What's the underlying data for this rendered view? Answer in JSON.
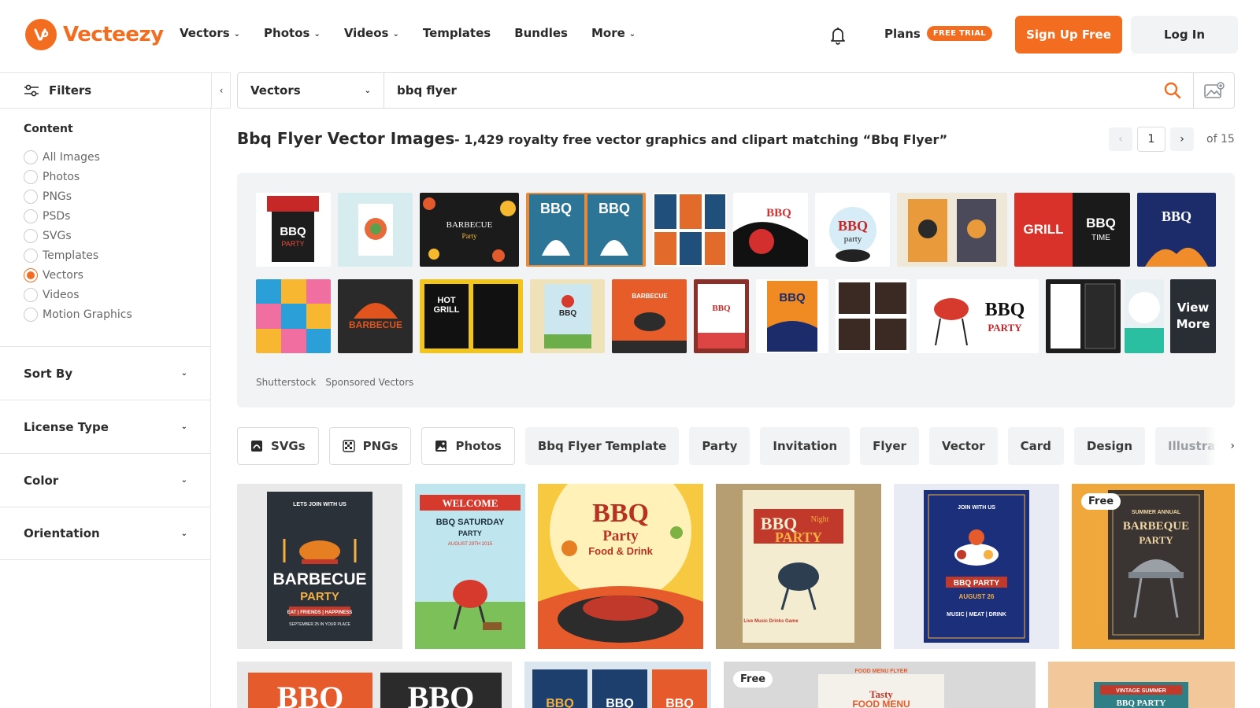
{
  "header": {
    "logo_text": "Vecteezy",
    "nav": [
      {
        "label": "Vectors",
        "has_dropdown": true
      },
      {
        "label": "Photos",
        "has_dropdown": true
      },
      {
        "label": "Videos",
        "has_dropdown": true
      },
      {
        "label": "Templates",
        "has_dropdown": false
      },
      {
        "label": "Bundles",
        "has_dropdown": false
      },
      {
        "label": "More",
        "has_dropdown": true
      }
    ],
    "plans_label": "Plans",
    "trial_badge": "FREE TRIAL",
    "signup_label": "Sign Up Free",
    "login_label": "Log In",
    "accent_color": "#f36d21"
  },
  "sidebar": {
    "filters_label": "Filters",
    "content_title": "Content",
    "content_options": [
      {
        "label": "All Images",
        "selected": false
      },
      {
        "label": "Photos",
        "selected": false
      },
      {
        "label": "PNGs",
        "selected": false
      },
      {
        "label": "PSDs",
        "selected": false
      },
      {
        "label": "SVGs",
        "selected": false
      },
      {
        "label": "Templates",
        "selected": false
      },
      {
        "label": "Vectors",
        "selected": true
      },
      {
        "label": "Videos",
        "selected": false
      },
      {
        "label": "Motion Graphics",
        "selected": false
      }
    ],
    "sections": [
      "Sort By",
      "License Type",
      "Color",
      "Orientation"
    ]
  },
  "search": {
    "type_selected": "Vectors",
    "query": "bbq flyer"
  },
  "results_header": {
    "title": "Bbq Flyer Vector Images",
    "subtitle": "- 1,429 royalty free vector graphics and clipart matching “Bbq Flyer”",
    "page": "1",
    "of_pages": "of 15"
  },
  "sponsored": {
    "provider": "Shutterstock",
    "label": "Sponsored Vectors",
    "view_more": "View More"
  },
  "chips": [
    {
      "label": "SVGs",
      "icon": "svg-file-icon",
      "outline": true
    },
    {
      "label": "PNGs",
      "icon": "png-checker-icon",
      "outline": true
    },
    {
      "label": "Photos",
      "icon": "photo-icon",
      "outline": true
    },
    {
      "label": "Bbq Flyer Template",
      "outline": false
    },
    {
      "label": "Party",
      "outline": false
    },
    {
      "label": "Invitation",
      "outline": false
    },
    {
      "label": "Flyer",
      "outline": false
    },
    {
      "label": "Vector",
      "outline": false
    },
    {
      "label": "Card",
      "outline": false
    },
    {
      "label": "Design",
      "outline": false
    },
    {
      "label": "Illustration",
      "outline": false
    }
  ],
  "results": {
    "free_badge": "Free",
    "cards": [
      {
        "line1": "LETS JOIN WITH US",
        "line2": "BARBECUE",
        "line3": "PARTY",
        "line4": "EAT | FRIENDS | HAPPINESS",
        "line5": "SEPTEMBER 25 IN YOUR PLACE"
      },
      {
        "line1": "WELCOME",
        "line2": "BBQ SATURDAY",
        "line3": "PARTY",
        "line4": "AUGUST 29TH 2015"
      },
      {
        "line1": "BBQ",
        "line2": "Party",
        "line3": "Food & Drink"
      },
      {
        "line1": "BBQ",
        "line2": "Night",
        "line3": "PARTY",
        "line4": "Live Music Drinks Game"
      },
      {
        "line1": "JOIN WITH US",
        "line2": "BBQ PARTY",
        "line3": "AUGUST 26",
        "line4": "MUSIC | MEAT | DRINK"
      },
      {
        "line1": "SUMMER ANNUAL",
        "line2": "BARBEQUE",
        "line3": "PARTY",
        "free": true
      },
      {
        "line1": "BBQ",
        "line2": "BBQ"
      },
      {
        "line1": "BBQ",
        "line2": "BBQ",
        "line3": "BBQ"
      },
      {
        "line1": "FOOD MENU FLYER",
        "line2": "Tasty",
        "line3": "FOOD MENU",
        "free": true
      },
      {
        "line1": "VINTAGE SUMMER",
        "line2": "BBQ PARTY"
      }
    ]
  }
}
